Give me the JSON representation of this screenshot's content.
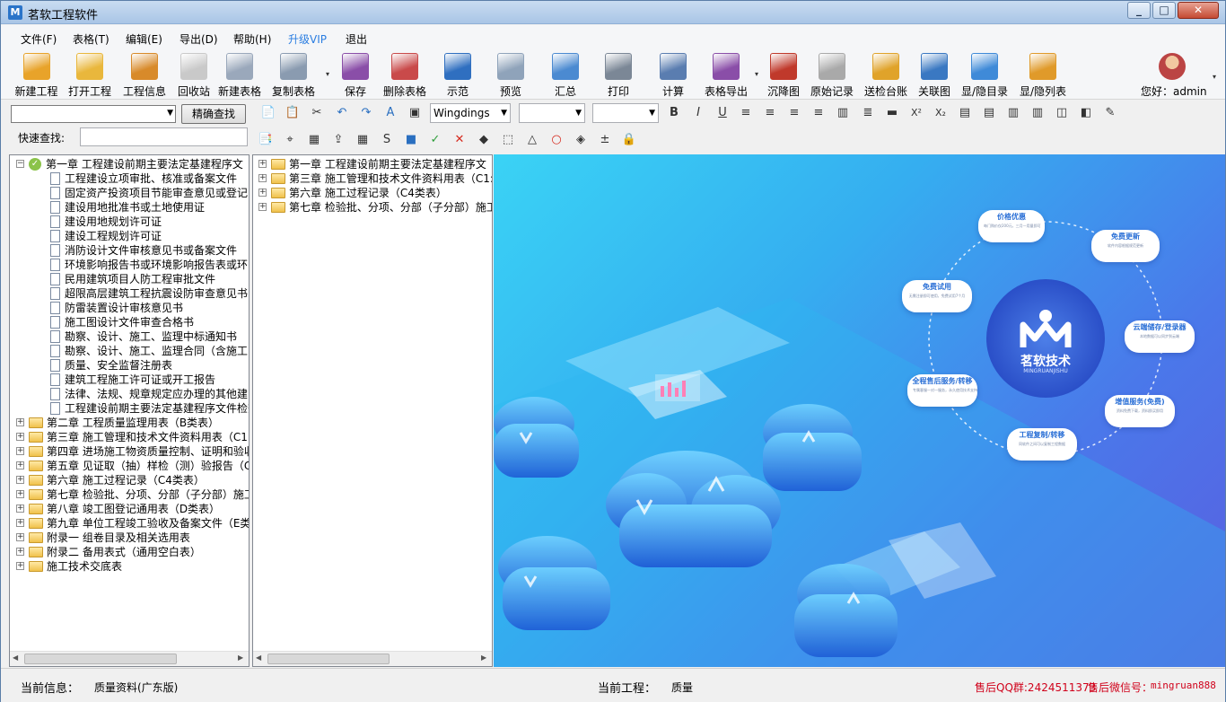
{
  "window": {
    "title": "茗软工程软件",
    "app_icon_letter": "M",
    "minimize": "_",
    "maximize": "□",
    "close": "✕"
  },
  "menu": {
    "items": [
      "文件(F)",
      "表格(T)",
      "编辑(E)",
      "导出(D)",
      "帮助(H)",
      "升级VIP",
      "退出"
    ],
    "vip_color": "#2a7de1"
  },
  "toolbar": {
    "buttons": [
      {
        "label": "新建工程",
        "icon": "new-project-icon",
        "color": "#e8a32a"
      },
      {
        "label": "打开工程",
        "icon": "open-folder-icon",
        "color": "#e9b73c"
      },
      {
        "label": "工程信息",
        "icon": "project-info-icon",
        "color": "#d88a2a"
      },
      {
        "label": "回收站",
        "icon": "recycle-bin-icon",
        "color": "#c9c9c9"
      },
      {
        "label": "新建表格",
        "icon": "new-table-icon",
        "color": "#9aa8bb"
      },
      {
        "label": "复制表格",
        "icon": "copy-table-icon",
        "color": "#8a9bb0"
      },
      {
        "label": "保存",
        "icon": "save-icon",
        "color": "#8a4ea8"
      },
      {
        "label": "删除表格",
        "icon": "delete-table-icon",
        "color": "#c94a4a"
      },
      {
        "label": "示范",
        "icon": "demo-book-icon",
        "color": "#2f6fc0"
      },
      {
        "label": "预览",
        "icon": "preview-icon",
        "color": "#8fa3ba"
      },
      {
        "label": "汇总",
        "icon": "summary-icon",
        "color": "#4b8ad1"
      },
      {
        "label": "打印",
        "icon": "printer-icon",
        "color": "#7b8796"
      },
      {
        "label": "计算",
        "icon": "calculator-icon",
        "color": "#5a7db0"
      },
      {
        "label": "表格导出",
        "icon": "export-icon",
        "color": "#8a4ea8"
      },
      {
        "label": "沉降图",
        "icon": "settlement-chart-icon",
        "color": "#c0392b"
      },
      {
        "label": "原始记录",
        "icon": "raw-record-icon",
        "color": "#a9a9a9"
      },
      {
        "label": "送检台账",
        "icon": "inspection-ledger-icon",
        "color": "#e0a32a"
      },
      {
        "label": "关联图",
        "icon": "image-link-icon",
        "color": "#3a78c2"
      },
      {
        "label": "显/隐目录",
        "icon": "toggle-catalog-icon",
        "color": "#3f8ad8"
      },
      {
        "label": "显/隐列表",
        "icon": "toggle-list-icon",
        "color": "#e09a2a"
      }
    ],
    "user_label": "您好：admin"
  },
  "search": {
    "exact_button": "精确查找",
    "quick_label": "快速查找:",
    "quick_value": ""
  },
  "format": {
    "font_name": "Wingdings",
    "font_size": "",
    "font_third": ""
  },
  "left_tree": [
    {
      "level": 0,
      "type": "check",
      "expanded": true,
      "text": "第一章 工程建设前期主要法定基建程序文"
    },
    {
      "level": 1,
      "type": "doc",
      "text": "工程建设立项审批、核准或备案文件"
    },
    {
      "level": 1,
      "type": "doc",
      "text": "固定资产投资项目节能审查意见或登记"
    },
    {
      "level": 1,
      "type": "doc",
      "text": "建设用地批准书或土地使用证"
    },
    {
      "level": 1,
      "type": "doc",
      "text": "建设用地规划许可证"
    },
    {
      "level": 1,
      "type": "doc",
      "text": "建设工程规划许可证"
    },
    {
      "level": 1,
      "type": "doc",
      "text": "消防设计文件审核意见书或备案文件"
    },
    {
      "level": 1,
      "type": "doc",
      "text": "环境影响报告书或环境影响报告表或环"
    },
    {
      "level": 1,
      "type": "doc",
      "text": "民用建筑项目人防工程审批文件"
    },
    {
      "level": 1,
      "type": "doc",
      "text": "超限高层建筑工程抗震设防审查意见书"
    },
    {
      "level": 1,
      "type": "doc",
      "text": "防雷装置设计审核意见书"
    },
    {
      "level": 1,
      "type": "doc",
      "text": "施工图设计文件审查合格书"
    },
    {
      "level": 1,
      "type": "doc",
      "text": "勘察、设计、施工、监理中标通知书"
    },
    {
      "level": 1,
      "type": "doc",
      "text": "勘察、设计、施工、监理合同（含施工"
    },
    {
      "level": 1,
      "type": "doc",
      "text": "质量、安全监督注册表"
    },
    {
      "level": 1,
      "type": "doc",
      "text": "建筑工程施工许可证或开工报告"
    },
    {
      "level": 1,
      "type": "doc",
      "text": "法律、法规、规章规定应办理的其他建"
    },
    {
      "level": 1,
      "type": "doc",
      "text": "工程建设前期主要法定基建程序文件检查表"
    },
    {
      "level": 0,
      "type": "folder",
      "text": "第二章 工程质量监理用表（B类表）"
    },
    {
      "level": 0,
      "type": "folder",
      "text": "第三章 施工管理和技术文件资料用表（C1:"
    },
    {
      "level": 0,
      "type": "folder",
      "text": "第四章 进场施工物资质量控制、证明和验收"
    },
    {
      "level": 0,
      "type": "folder",
      "text": "第五章 见证取（抽）样检（测）验报告（C"
    },
    {
      "level": 0,
      "type": "folder",
      "text": "第六章 施工过程记录（C4类表）"
    },
    {
      "level": 0,
      "type": "folder",
      "text": "第七章 检验批、分项、分部（子分部）施工"
    },
    {
      "level": 0,
      "type": "folder",
      "text": "第八章 竣工图登记通用表（D类表）"
    },
    {
      "level": 0,
      "type": "folder",
      "text": "第九章 单位工程竣工验收及备案文件（E类"
    },
    {
      "level": 0,
      "type": "folder",
      "text": "附录一 组卷目录及相关选用表"
    },
    {
      "level": 0,
      "type": "folder",
      "text": "附录二 备用表式（通用空白表）"
    },
    {
      "level": 0,
      "type": "folder",
      "text": "施工技术交底表"
    }
  ],
  "mid_tree": [
    {
      "text": "第一章 工程建设前期主要法定基建程序文"
    },
    {
      "text": "第三章 施工管理和技术文件资料用表（C1:"
    },
    {
      "text": "第六章 施工过程记录（C4类表）"
    },
    {
      "text": "第七章 检验批、分项、分部（子分部）施工"
    }
  ],
  "banner": {
    "brand": "茗软技术",
    "brand_sub": "MINGRUANJISHU",
    "bubbles": [
      {
        "title": "价格优惠",
        "desc": "每门购价仅200元，三月一用量即可"
      },
      {
        "title": "免费更新",
        "desc": "软件内容根据规范更新"
      },
      {
        "title": "免费试用",
        "desc": "无需注册即可使用，免费试用7个月"
      },
      {
        "title": "云端储存/登录器",
        "desc": "本地数据可以同步到云端"
      },
      {
        "title": "全程售后服务/转移",
        "desc": "专属客服一对一服务，永久使用技术支持"
      },
      {
        "title": "增值服务(免费)",
        "desc": "资料免费下载，资料即买即用"
      },
      {
        "title": "工程复制/转移",
        "desc": "同软件之间可以复制工程数据"
      }
    ]
  },
  "status": {
    "info_label": "当前信息：",
    "info_value": "质量资料(广东版)",
    "project_label": "当前工程：",
    "project_value": "质量",
    "qq": "售后QQ群:2424511373",
    "wechat_label": "售后微信号：",
    "wechat_value": "mingruan888",
    "red_color": "#d0021b"
  }
}
